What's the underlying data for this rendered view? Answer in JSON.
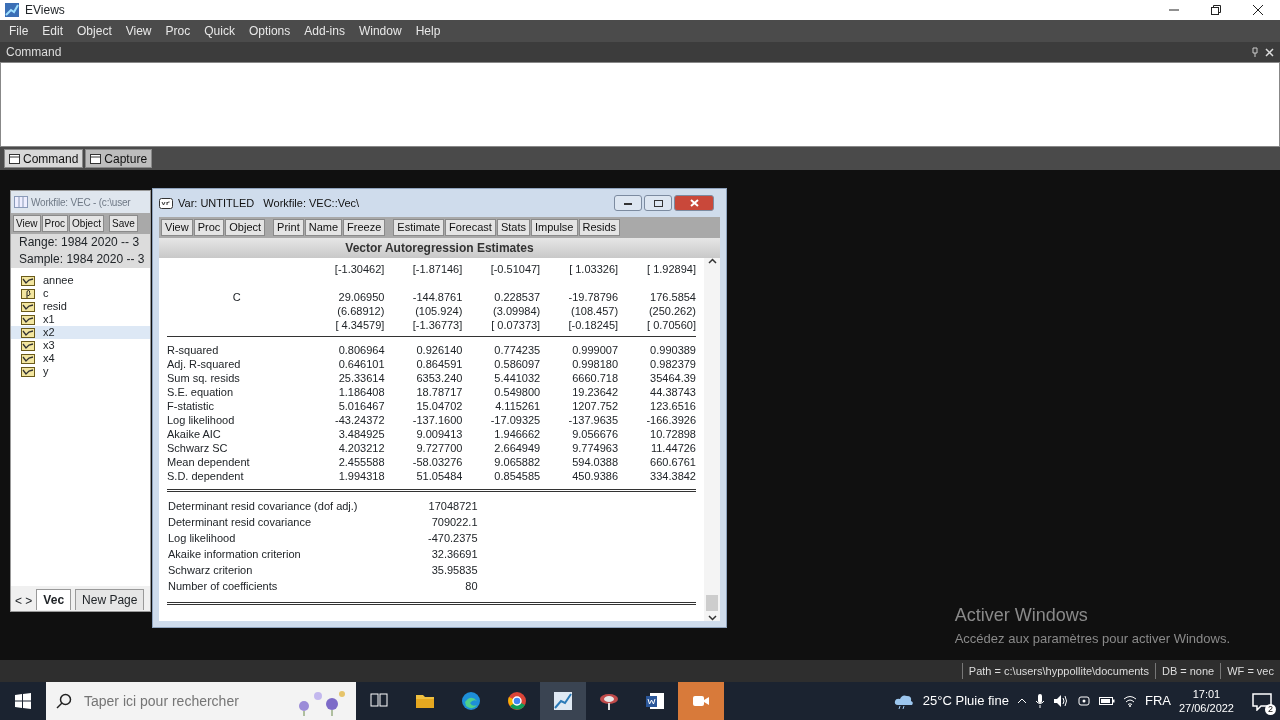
{
  "app": {
    "title": "EViews"
  },
  "menu": [
    "File",
    "Edit",
    "Object",
    "View",
    "Proc",
    "Quick",
    "Options",
    "Add-ins",
    "Window",
    "Help"
  ],
  "command_panel": {
    "title": "Command"
  },
  "command_tabs": [
    {
      "label": "Command",
      "selected": true
    },
    {
      "label": "Capture",
      "selected": false
    }
  ],
  "workfile": {
    "title": "Workfile: VEC - (c:\\user",
    "toolbar": [
      [
        "View",
        "Proc",
        "Object"
      ],
      [
        "Save"
      ]
    ],
    "range_label": "Range:",
    "range": "1984 2020  --  3",
    "sample_label": "Sample:",
    "sample": "1984 2020  --  3",
    "objects": [
      {
        "name": "annee",
        "kind": "series",
        "selected": false
      },
      {
        "name": "c",
        "kind": "coef",
        "selected": false
      },
      {
        "name": "resid",
        "kind": "series",
        "selected": false
      },
      {
        "name": "x1",
        "kind": "series",
        "selected": false
      },
      {
        "name": "x2",
        "kind": "series",
        "selected": true
      },
      {
        "name": "x3",
        "kind": "series",
        "selected": false
      },
      {
        "name": "x4",
        "kind": "series",
        "selected": false
      },
      {
        "name": "y",
        "kind": "series",
        "selected": false
      }
    ],
    "nav": "< >",
    "page_tabs": [
      {
        "label": "Vec",
        "selected": true
      },
      {
        "label": "New Page",
        "selected": false
      }
    ]
  },
  "var_window": {
    "title": "Var: UNTITLED   Workfile: VEC::Vec\\",
    "toolbar": [
      [
        "View",
        "Proc",
        "Object"
      ],
      [
        "Print",
        "Name",
        "Freeze"
      ],
      [
        "Estimate",
        "Forecast",
        "Stats",
        "Impulse",
        "Resids"
      ]
    ],
    "heading": "Vector Autoregression Estimates",
    "coef_rows": [
      {
        "label": "",
        "values": [
          "[-1.30462]",
          "[-1.87146]",
          "[-0.51047]",
          "[ 1.03326]",
          "[ 1.92894]"
        ]
      },
      {
        "label": "C",
        "values": [
          "29.06950",
          "-144.8761",
          "0.228537",
          "-19.78796",
          "176.5854"
        ]
      },
      {
        "label": "",
        "values": [
          "(6.68912)",
          "(105.924)",
          "(3.09984)",
          "(108.457)",
          "(250.262)"
        ]
      },
      {
        "label": "",
        "values": [
          "[ 4.34579]",
          "[-1.36773]",
          "[ 0.07373]",
          "[-0.18245]",
          "[ 0.70560]"
        ]
      }
    ],
    "stats": [
      {
        "label": "R-squared",
        "values": [
          "0.806964",
          "0.926140",
          "0.774235",
          "0.999007",
          "0.990389"
        ]
      },
      {
        "label": "Adj. R-squared",
        "values": [
          "0.646101",
          "0.864591",
          "0.586097",
          "0.998180",
          "0.982379"
        ]
      },
      {
        "label": "Sum sq. resids",
        "values": [
          "25.33614",
          "6353.240",
          "5.441032",
          "6660.718",
          "35464.39"
        ]
      },
      {
        "label": "S.E. equation",
        "values": [
          "1.186408",
          "18.78717",
          "0.549800",
          "19.23642",
          "44.38743"
        ]
      },
      {
        "label": "F-statistic",
        "values": [
          "5.016467",
          "15.04702",
          "4.115261",
          "1207.752",
          "123.6516"
        ]
      },
      {
        "label": "Log likelihood",
        "values": [
          "-43.24372",
          "-137.1600",
          "-17.09325",
          "-137.9635",
          "-166.3926"
        ]
      },
      {
        "label": "Akaike AIC",
        "values": [
          "3.484925",
          "9.009413",
          "1.946662",
          "9.056676",
          "10.72898"
        ]
      },
      {
        "label": "Schwarz SC",
        "values": [
          "4.203212",
          "9.727700",
          "2.664949",
          "9.774963",
          "11.44726"
        ]
      },
      {
        "label": "Mean dependent",
        "values": [
          "2.455588",
          "-58.03276",
          "9.065882",
          "594.0388",
          "660.6761"
        ]
      },
      {
        "label": "S.D. dependent",
        "values": [
          "1.994318",
          "51.05484",
          "0.854585",
          "450.9386",
          "334.3842"
        ]
      }
    ],
    "summary": [
      {
        "label": "Determinant resid covariance (dof adj.)",
        "value": "17048721"
      },
      {
        "label": "Determinant resid covariance",
        "value": "709022.1"
      },
      {
        "label": "Log likelihood",
        "value": "-470.2375"
      },
      {
        "label": "Akaike information criterion",
        "value": "32.36691"
      },
      {
        "label": "Schwarz criterion",
        "value": "35.95835"
      },
      {
        "label": "Number of coefficients",
        "value": "80"
      }
    ]
  },
  "activation_notice": {
    "title": "Activer Windows",
    "text": "Accédez aux paramètres pour activer Windows."
  },
  "status_bar": [
    "Path = c:\\users\\hyppollite\\documents",
    "DB = none",
    "WF = vec"
  ],
  "taskbar": {
    "search_placeholder": "Taper ici pour rechercher",
    "weather": "25°C  Pluie fine",
    "language": "FRA",
    "time": "17:01",
    "date": "27/06/2022",
    "notifications": "2"
  }
}
